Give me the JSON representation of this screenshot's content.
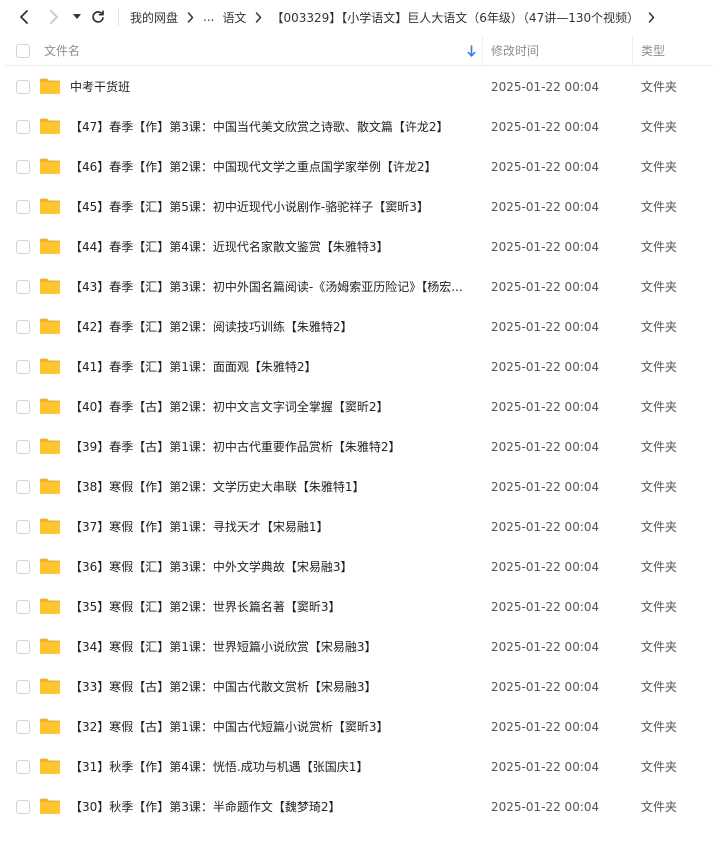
{
  "breadcrumb": [
    {
      "label": "我的网盘"
    },
    {
      "label": "..."
    },
    {
      "label": "语文"
    },
    {
      "label": "【003329】【小学语文】巨人大语文（6年级）（47讲—130个视频）"
    }
  ],
  "header": {
    "name_label": "文件名",
    "time_label": "修改时间",
    "type_label": "类型"
  },
  "colors": {
    "folder": "#ffc531",
    "folder_back": "#f5b316",
    "sort_arrow": "#2f7bf4"
  },
  "icons": [
    "back-icon",
    "forward-icon",
    "dropdown-icon",
    "refresh-icon",
    "chevron-right-icon",
    "sort-arrow-icon",
    "folder-icon"
  ],
  "rows": [
    {
      "name": "中考干货班",
      "time": "2025-01-22 00:04",
      "type": "文件夹"
    },
    {
      "name": "【47】春季【作】第3课：中国当代美文欣赏之诗歌、散文篇【许龙2】",
      "time": "2025-01-22 00:04",
      "type": "文件夹"
    },
    {
      "name": "【46】春季【作】第2课：中国现代文学之重点国学家举例【许龙2】",
      "time": "2025-01-22 00:04",
      "type": "文件夹"
    },
    {
      "name": "【45】春季【汇】第5课：初中近现代小说剧作-骆驼祥子【窦昕3】",
      "time": "2025-01-22 00:04",
      "type": "文件夹"
    },
    {
      "name": "【44】春季【汇】第4课：近现代名家散文鉴赏【朱雅特3】",
      "time": "2025-01-22 00:04",
      "type": "文件夹"
    },
    {
      "name": "【43】春季【汇】第3课：初中外国名篇阅读-《汤姆索亚历险记》【杨宏...",
      "time": "2025-01-22 00:04",
      "type": "文件夹"
    },
    {
      "name": "【42】春季【汇】第2课：阅读技巧训练【朱雅特2】",
      "time": "2025-01-22 00:04",
      "type": "文件夹"
    },
    {
      "name": "【41】春季【汇】第1课：面面观【朱雅特2】",
      "time": "2025-01-22 00:04",
      "type": "文件夹"
    },
    {
      "name": "【40】春季【古】第2课：初中文言文字词全掌握【窦昕2】",
      "time": "2025-01-22 00:04",
      "type": "文件夹"
    },
    {
      "name": "【39】春季【古】第1课：初中古代重要作品赏析【朱雅特2】",
      "time": "2025-01-22 00:04",
      "type": "文件夹"
    },
    {
      "name": "【38】寒假【作】第2课：文学历史大串联【朱雅特1】",
      "time": "2025-01-22 00:04",
      "type": "文件夹"
    },
    {
      "name": "【37】寒假【作】第1课：寻找天才【宋易融1】",
      "time": "2025-01-22 00:04",
      "type": "文件夹"
    },
    {
      "name": "【36】寒假【汇】第3课：中外文学典故【宋易融3】",
      "time": "2025-01-22 00:04",
      "type": "文件夹"
    },
    {
      "name": "【35】寒假【汇】第2课：世界长篇名著【窦昕3】",
      "time": "2025-01-22 00:04",
      "type": "文件夹"
    },
    {
      "name": "【34】寒假【汇】第1课：世界短篇小说欣赏【宋易融3】",
      "time": "2025-01-22 00:04",
      "type": "文件夹"
    },
    {
      "name": "【33】寒假【古】第2课：中国古代散文赏析【宋易融3】",
      "time": "2025-01-22 00:04",
      "type": "文件夹"
    },
    {
      "name": "【32】寒假【古】第1课：中国古代短篇小说赏析【窦昕3】",
      "time": "2025-01-22 00:04",
      "type": "文件夹"
    },
    {
      "name": "【31】秋季【作】第4课：恍悟.成功与机遇【张国庆1】",
      "time": "2025-01-22 00:04",
      "type": "文件夹"
    },
    {
      "name": "【30】秋季【作】第3课：半命题作文【魏梦琦2】",
      "time": "2025-01-22 00:04",
      "type": "文件夹"
    }
  ]
}
